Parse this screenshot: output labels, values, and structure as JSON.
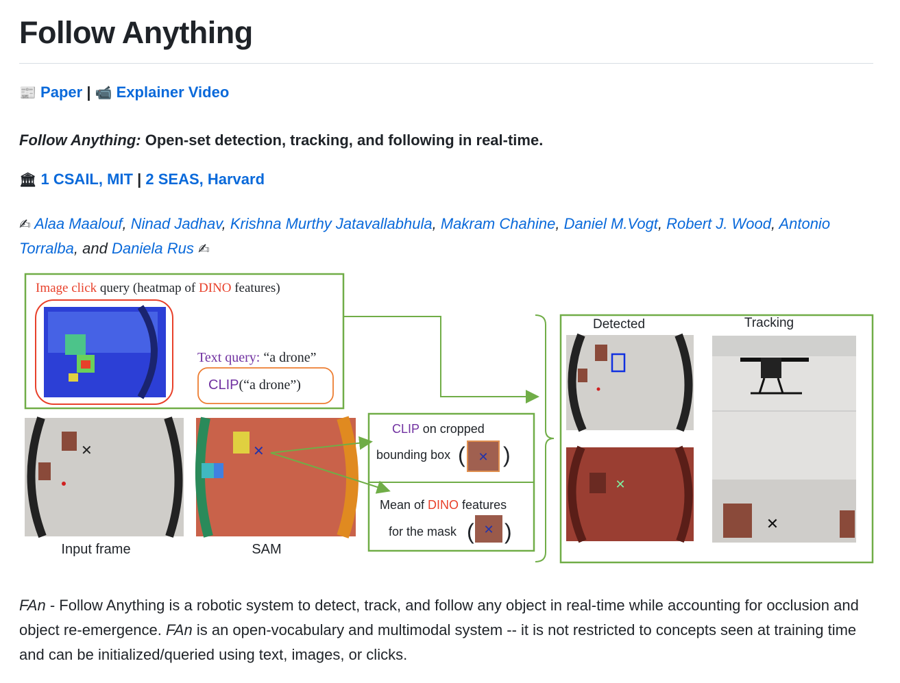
{
  "title": "Follow Anything",
  "links": {
    "paper_emoji": "📰",
    "paper": "Paper",
    "sep": "|",
    "video_emoji": "📹",
    "video": "Explainer Video"
  },
  "tagline": {
    "em": "Follow Anything:",
    "rest": " Open-set detection, tracking, and following in real-time."
  },
  "affiliations": {
    "emoji": "🏛",
    "a1": "1 CSAIL, MIT",
    "sep": "|",
    "a2": "2 SEAS, Harvard"
  },
  "authors": {
    "emoji": "✍",
    "names": [
      "Alaa Maalouf",
      "Ninad Jadhav",
      "Krishna Murthy Jatavallabhula",
      "Makram Chahine",
      "Daniel M.Vogt",
      "Robert J. Wood",
      "Antonio Torralba",
      "Daniela Rus"
    ],
    "and": "and"
  },
  "figure": {
    "image_click_1": "Image click",
    "image_click_2": " query (heatmap of ",
    "image_click_3": "DINO",
    "image_click_4": " features)",
    "text_query_1": "Text query:",
    "text_query_2": " “a drone”",
    "clip_1": "CLIP",
    "clip_2": "(“a drone”)",
    "clip_crop_1": "CLIP",
    "clip_crop_2": " on cropped",
    "bbox": "bounding box",
    "mean_1": "Mean of ",
    "mean_2": "DINO",
    "mean_3": " features",
    "for_mask": "for the mask",
    "input_frame": "Input frame",
    "sam": "SAM",
    "detected": "Detected",
    "tracking": "Tracking"
  },
  "description": {
    "p1_em": "FAn",
    "p1": " - Follow Anything is a robotic system to detect, track, and follow any object in real-time while accounting for occlusion and object re-emergence. ",
    "p2_em": "FAn",
    "p2": " is an open-vocabulary and multimodal system -- it is not restricted to concepts seen at training time and can be initialized/queried using text, images, or clicks."
  },
  "colors": {
    "link": "#0969da",
    "frame_green": "#70ad47",
    "accent_red": "#e8402a",
    "accent_purple": "#7030a0",
    "orange": "#ed7d31"
  }
}
